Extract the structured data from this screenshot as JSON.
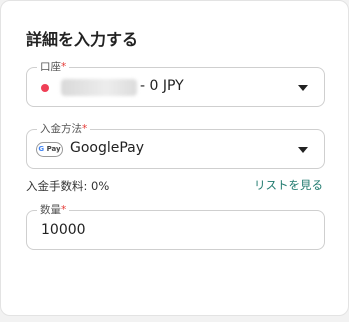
{
  "form": {
    "title": "詳細を入力する",
    "account": {
      "label": "口座",
      "required_mark": "*",
      "value_suffix": "- 0 JPY",
      "status_color": "#ef3f56"
    },
    "payment_method": {
      "label": "入金方法",
      "required_mark": "*",
      "value": "GooglePay",
      "icon": "google-pay-icon",
      "icon_text_g": "G",
      "icon_text_pay": "Pay"
    },
    "fee": {
      "text": "入金手数料: 0%",
      "link_label": "リストを見る",
      "link_color": "#1f7a6e"
    },
    "quantity": {
      "label": "数量",
      "required_mark": "*",
      "value": "10000"
    }
  }
}
